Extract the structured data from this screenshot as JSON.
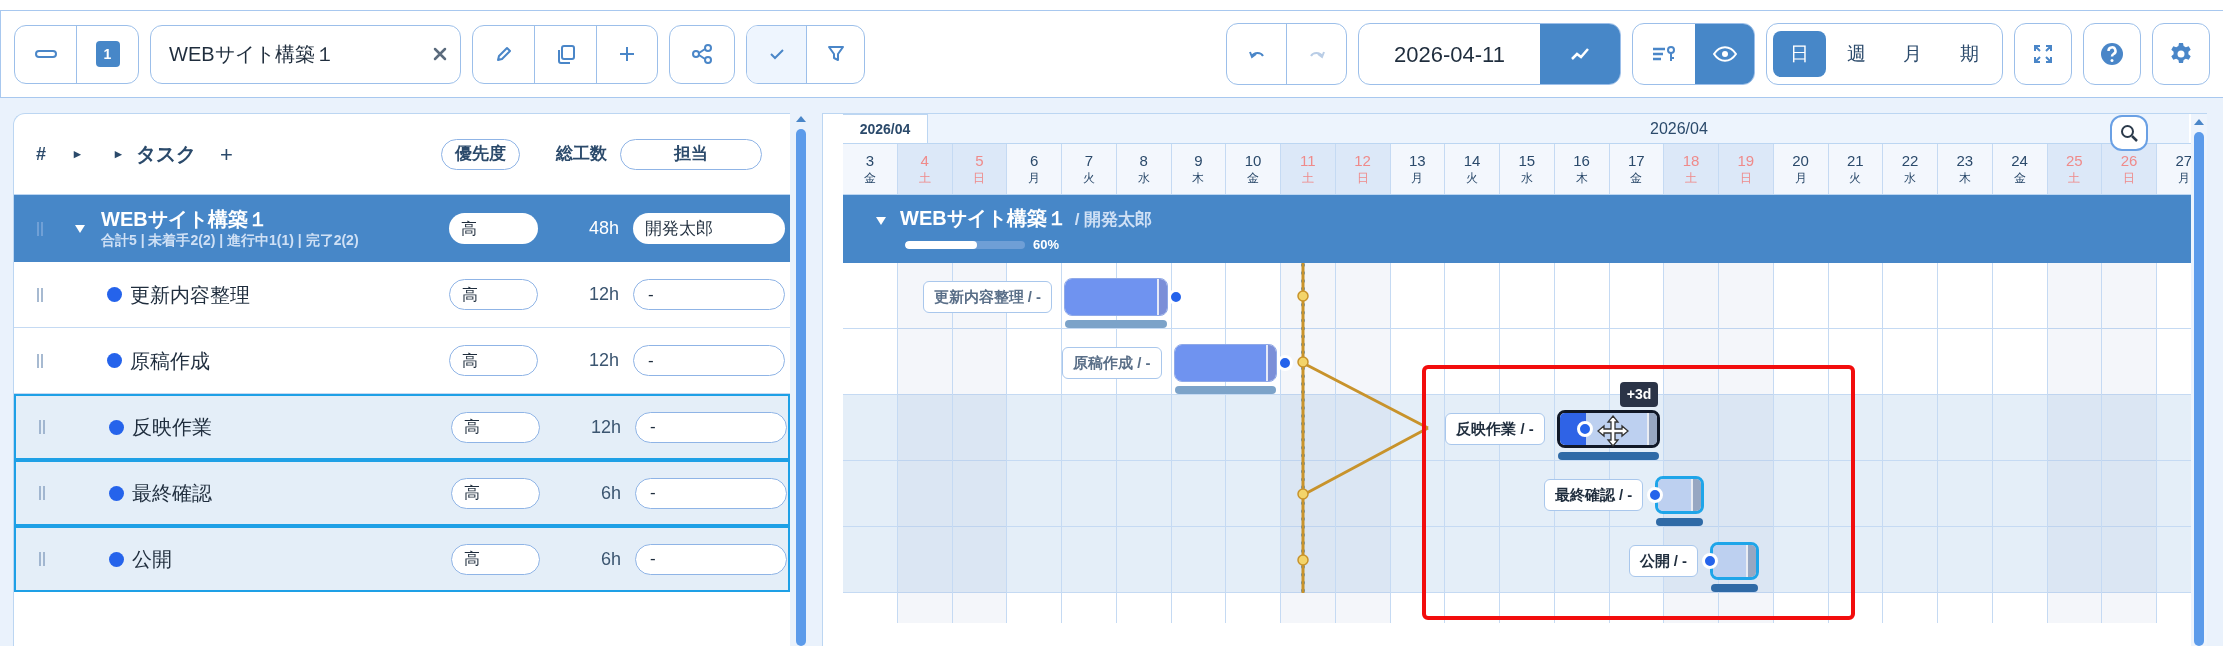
{
  "toolbar": {
    "level_badge": "1",
    "search": {
      "value": "WEBサイト構築１"
    },
    "check_active": true,
    "redo_disabled": true,
    "date": "2026-04-11",
    "trend_active": true,
    "eye_active": true,
    "view_tabs": [
      {
        "label": "日",
        "selected": true
      },
      {
        "label": "週",
        "selected": false
      },
      {
        "label": "月",
        "selected": false
      },
      {
        "label": "期",
        "selected": false
      }
    ]
  },
  "task_table": {
    "columns": [
      "#",
      "▸",
      "▸",
      "タスク",
      "+",
      "優先度",
      "総工数",
      "担当"
    ]
  },
  "project": {
    "name": "WEBサイト構築１",
    "summary": "合計5 | 未着手2(2) | 進行中1(1) | 完了2(2)",
    "priority": "高",
    "hours": "48h",
    "assignee": "開発太郎",
    "expanded": true
  },
  "tasks": [
    {
      "name": "更新内容整理",
      "priority": "高",
      "hours": "12h",
      "assignee": "-",
      "selected": false,
      "bar": {
        "label": "更新内容整理 / -",
        "level": 1,
        "dragging": false
      }
    },
    {
      "name": "原稿作成",
      "priority": "高",
      "hours": "12h",
      "assignee": "-",
      "selected": false,
      "bar": {
        "label": "原稿作成 / -",
        "level": 1,
        "dragging": false
      }
    },
    {
      "name": "反映作業",
      "priority": "高",
      "hours": "12h",
      "assignee": "-",
      "selected": true,
      "bar": {
        "label": "反映作業 / -",
        "level": 0.3,
        "dragging": true,
        "hint": "+3d"
      }
    },
    {
      "name": "最終確認",
      "priority": "高",
      "hours": "6h",
      "assignee": "-",
      "selected": true,
      "bar": {
        "label": "最終確認 / -",
        "level": 0,
        "dragging": false
      }
    },
    {
      "name": "公開",
      "priority": "高",
      "hours": "6h",
      "assignee": "-",
      "selected": true,
      "bar": {
        "label": "公開 / -",
        "level": 0,
        "dragging": false
      }
    }
  ],
  "gantt": {
    "month_tab": "2026/04",
    "month_label": "2026/04",
    "group": {
      "name": "WEBサイト構築１",
      "assignee": "/ 開発太郎",
      "level": 0.6,
      "percent": "60%"
    },
    "days": [
      {
        "day": "3",
        "weekday": "金",
        "weekend": false
      },
      {
        "day": "4",
        "weekday": "土",
        "weekend": true
      },
      {
        "day": "5",
        "weekday": "日",
        "weekend": true
      },
      {
        "day": "6",
        "weekday": "月",
        "weekend": false
      },
      {
        "day": "7",
        "weekday": "火",
        "weekend": false
      },
      {
        "day": "8",
        "weekday": "水",
        "weekend": false
      },
      {
        "day": "9",
        "weekday": "木",
        "weekend": false
      },
      {
        "day": "10",
        "weekday": "金",
        "weekend": false
      },
      {
        "day": "11",
        "weekday": "土",
        "weekend": true,
        "today": true
      },
      {
        "day": "12",
        "weekday": "日",
        "weekend": true
      },
      {
        "day": "13",
        "weekday": "月",
        "weekend": false
      },
      {
        "day": "14",
        "weekday": "火",
        "weekend": false
      },
      {
        "day": "15",
        "weekday": "水",
        "weekend": false
      },
      {
        "day": "16",
        "weekday": "木",
        "weekend": false
      },
      {
        "day": "17",
        "weekday": "金",
        "weekend": false
      },
      {
        "day": "18",
        "weekday": "土",
        "weekend": true
      },
      {
        "day": "19",
        "weekday": "日",
        "weekend": true
      },
      {
        "day": "20",
        "weekday": "月",
        "weekend": false
      },
      {
        "day": "21",
        "weekday": "火",
        "weekend": false
      },
      {
        "day": "22",
        "weekday": "水",
        "weekend": false
      },
      {
        "day": "23",
        "weekday": "木",
        "weekend": false
      },
      {
        "day": "24",
        "weekday": "金",
        "weekend": false
      },
      {
        "day": "25",
        "weekday": "土",
        "weekend": true
      },
      {
        "day": "26",
        "weekday": "日",
        "weekend": true
      },
      {
        "day": "27",
        "weekday": "月",
        "weekend": false
      }
    ]
  }
}
